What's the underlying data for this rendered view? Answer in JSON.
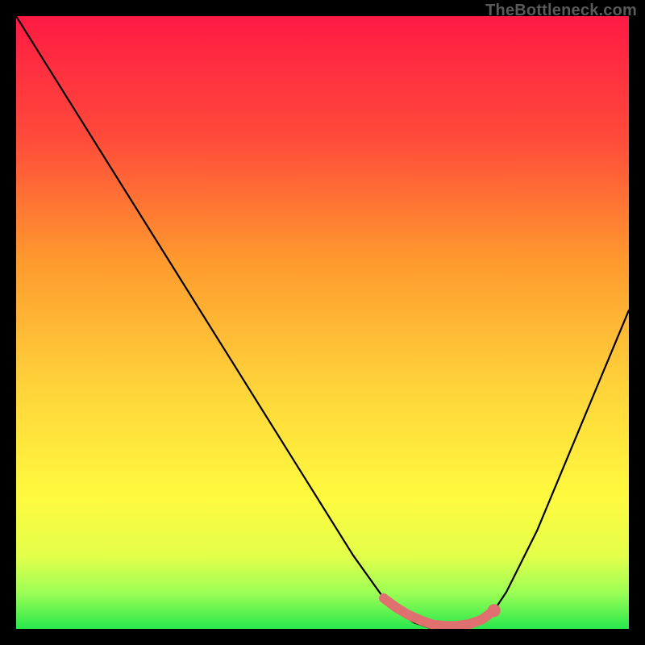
{
  "attribution": "TheBottleneck.com",
  "chart_data": {
    "type": "line",
    "title": "",
    "xlabel": "",
    "ylabel": "",
    "xlim": [
      0,
      100
    ],
    "ylim": [
      0,
      100
    ],
    "series": [
      {
        "name": "black-curve",
        "x": [
          0,
          5,
          10,
          15,
          20,
          25,
          30,
          35,
          40,
          45,
          50,
          55,
          60,
          62,
          65,
          68,
          70,
          72,
          75,
          78,
          80,
          85,
          90,
          95,
          100
        ],
        "values": [
          100,
          92,
          84,
          76,
          68,
          60,
          52,
          44,
          36,
          28,
          20,
          12,
          5,
          3,
          1,
          0,
          0,
          0,
          1,
          3,
          6,
          16,
          28,
          40,
          52
        ]
      },
      {
        "name": "red-segment",
        "x": [
          60,
          62,
          64,
          66,
          68,
          70,
          72,
          74,
          76,
          78
        ],
        "values": [
          5,
          3.5,
          2.3,
          1.4,
          0.7,
          0.5,
          0.5,
          0.8,
          1.5,
          3
        ]
      }
    ],
    "gradient_stops": [
      {
        "offset": 0.0,
        "color": "#ff1a44"
      },
      {
        "offset": 0.2,
        "color": "#ff4b3a"
      },
      {
        "offset": 0.4,
        "color": "#ff9a2e"
      },
      {
        "offset": 0.6,
        "color": "#ffd23a"
      },
      {
        "offset": 0.78,
        "color": "#fff93e"
      },
      {
        "offset": 0.88,
        "color": "#e4ff4a"
      },
      {
        "offset": 0.94,
        "color": "#9eff55"
      },
      {
        "offset": 1.0,
        "color": "#29e84d"
      }
    ],
    "red_stroke": "#e07070",
    "marker_point": {
      "x": 78,
      "y": 3
    },
    "legend": null,
    "grid": false
  }
}
